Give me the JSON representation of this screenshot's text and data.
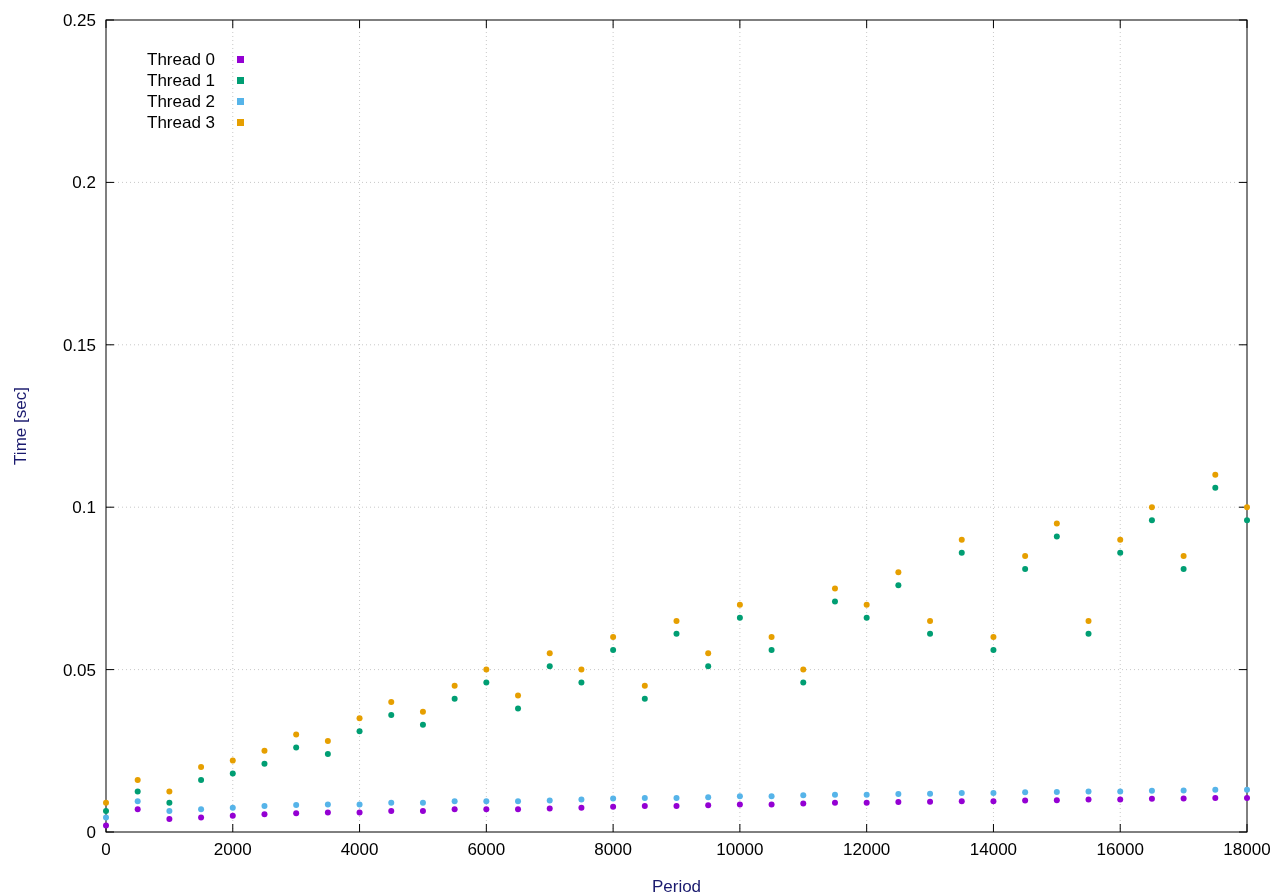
{
  "chart_data": {
    "type": "scatter",
    "xlabel": "Period",
    "ylabel": "Time [sec]",
    "xlim": [
      0,
      18000
    ],
    "ylim": [
      0,
      0.25
    ],
    "grid": true,
    "legend": "upper left",
    "xticks": [
      0,
      2000,
      4000,
      6000,
      8000,
      10000,
      12000,
      14000,
      16000,
      18000
    ],
    "yticks": [
      {
        "value": 0,
        "label": "0"
      },
      {
        "value": 0.05,
        "label": "0.05"
      },
      {
        "value": 0.1,
        "label": "0.1"
      },
      {
        "value": 0.15,
        "label": "0.15"
      },
      {
        "value": 0.2,
        "label": "0.2"
      },
      {
        "value": 0.25,
        "label": "0.25"
      }
    ],
    "x": [
      0,
      500,
      1000,
      1500,
      2000,
      2500,
      3000,
      3500,
      4000,
      4500,
      5000,
      5500,
      6000,
      6500,
      7000,
      7500,
      8000,
      8500,
      9000,
      9500,
      10000,
      10500,
      11000,
      11500,
      12000,
      12500,
      13000,
      13500,
      14000,
      14500,
      15000,
      15500,
      16000,
      16500,
      17000,
      17500,
      18000
    ],
    "series": [
      {
        "name": "Thread 0",
        "color": "#9400d3",
        "values": [
          0.002,
          0.007,
          0.004,
          0.0045,
          0.005,
          0.0055,
          0.0058,
          0.006,
          0.006,
          0.0065,
          0.0065,
          0.007,
          0.007,
          0.007,
          0.0072,
          0.0075,
          0.0078,
          0.008,
          0.008,
          0.0082,
          0.0085,
          0.0085,
          0.0088,
          0.009,
          0.009,
          0.0092,
          0.0093,
          0.0095,
          0.0095,
          0.0097,
          0.0098,
          0.01,
          0.01,
          0.0102,
          0.0103,
          0.0105,
          0.0105
        ]
      },
      {
        "name": "Thread 1",
        "color": "#009e73",
        "values": [
          0.0065,
          0.0125,
          0.009,
          0.016,
          0.018,
          0.021,
          0.026,
          0.024,
          0.031,
          0.036,
          0.033,
          0.041,
          0.046,
          0.038,
          0.051,
          0.046,
          0.056,
          0.041,
          0.061,
          0.051,
          0.066,
          0.056,
          0.046,
          0.071,
          0.066,
          0.076,
          0.061,
          0.086,
          0.056,
          0.081,
          0.091,
          0.061,
          0.086,
          0.096,
          0.081,
          0.106,
          0.096
        ]
      },
      {
        "name": "Thread 2",
        "color": "#56b4e9",
        "values": [
          0.0045,
          0.0095,
          0.0065,
          0.007,
          0.0075,
          0.008,
          0.0083,
          0.0085,
          0.0085,
          0.009,
          0.009,
          0.0095,
          0.0095,
          0.0095,
          0.0097,
          0.01,
          0.0103,
          0.0105,
          0.0105,
          0.0107,
          0.011,
          0.011,
          0.0113,
          0.0115,
          0.0115,
          0.0117,
          0.0118,
          0.012,
          0.012,
          0.0122,
          0.0123,
          0.0125,
          0.0125,
          0.0127,
          0.0128,
          0.013,
          0.013
        ]
      },
      {
        "name": "Thread 3",
        "color": "#e69f00",
        "values": [
          0.009,
          0.016,
          0.0125,
          0.02,
          0.022,
          0.025,
          0.03,
          0.028,
          0.035,
          0.04,
          0.037,
          0.045,
          0.05,
          0.042,
          0.055,
          0.05,
          0.06,
          0.045,
          0.065,
          0.055,
          0.07,
          0.06,
          0.05,
          0.075,
          0.07,
          0.08,
          0.065,
          0.09,
          0.06,
          0.085,
          0.095,
          0.065,
          0.09,
          0.1,
          0.085,
          0.11,
          0.1
        ]
      }
    ]
  }
}
